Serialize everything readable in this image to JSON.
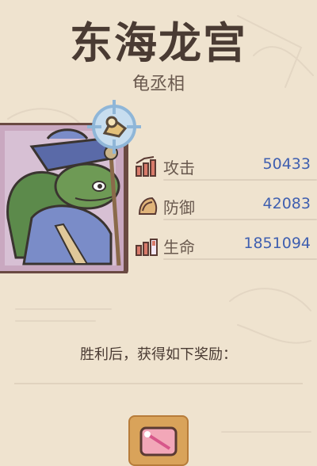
{
  "title": "东海龙宫",
  "subtitle": "龟丞相",
  "stats": [
    {
      "label": "攻击",
      "value": "50433",
      "icon": "attack-icon"
    },
    {
      "label": "防御",
      "value": "42083",
      "icon": "defense-icon"
    },
    {
      "label": "生命",
      "value": "1851094",
      "icon": "health-icon"
    }
  ],
  "reward_text": "胜利后，获得如下奖励：",
  "colors": {
    "accent_value": "#3f5fb0",
    "background": "#efe3cf",
    "text": "#4a3b33"
  }
}
